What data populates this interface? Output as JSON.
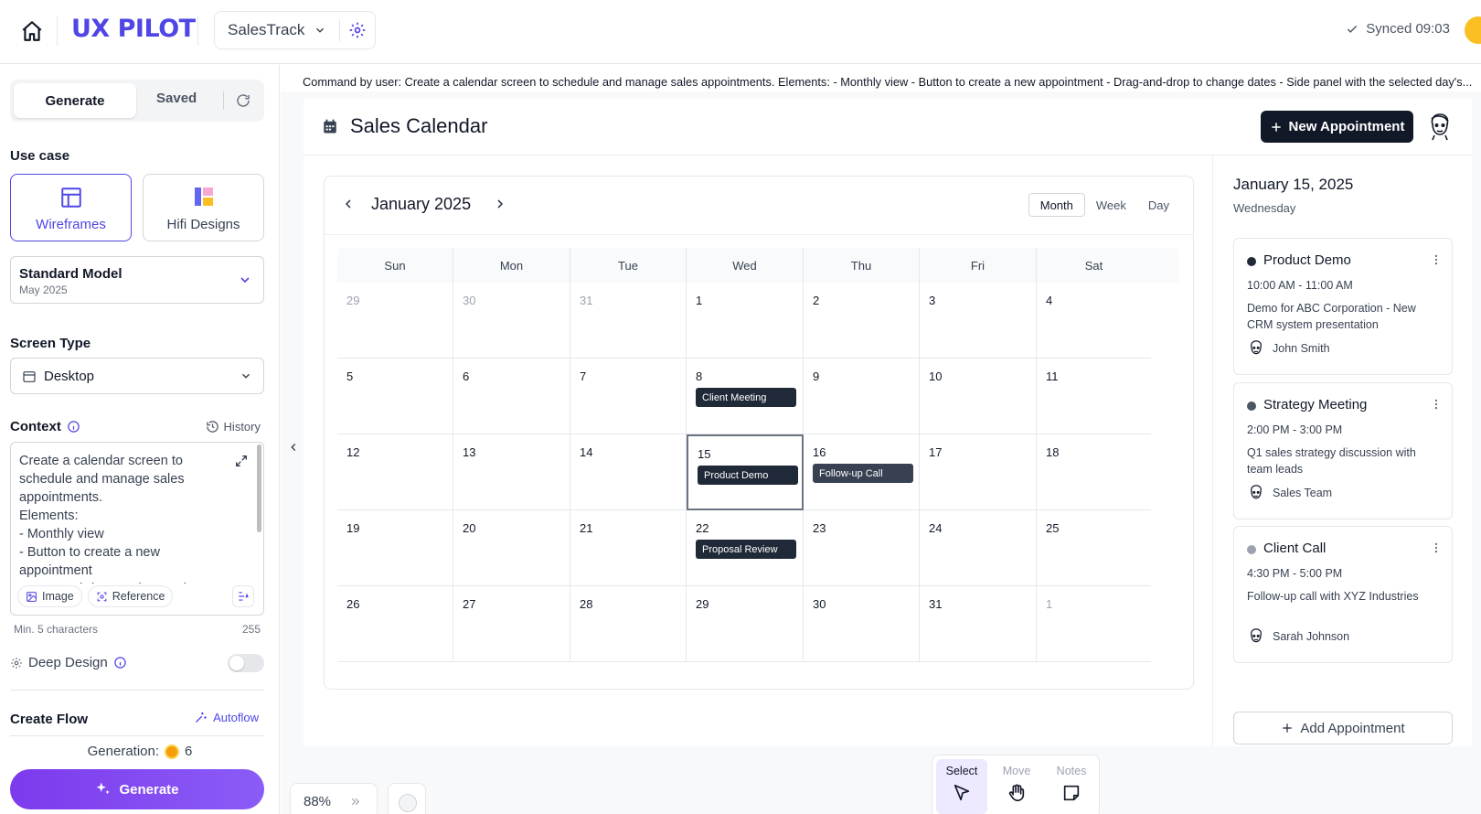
{
  "app": {
    "logo": "UX PILOT",
    "project": "SalesTrack",
    "sync_status": "Synced 09:03"
  },
  "left": {
    "tabs": {
      "generate": "Generate",
      "saved": "Saved"
    },
    "use_case_label": "Use case",
    "use_cases": [
      {
        "label": "Wireframes"
      },
      {
        "label": "Hifi Designs"
      }
    ],
    "model": {
      "name": "Standard Model",
      "date": "May 2025"
    },
    "screen_type_label": "Screen Type",
    "screen_type": "Desktop",
    "context_label": "Context",
    "history_label": "History",
    "context_text": "Create a calendar screen to schedule and manage sales appointments.\nElements:\n- Monthly view\n- Button to create a new appointment\n- Drag-and-drop to change dates",
    "chips": {
      "image": "Image",
      "reference": "Reference"
    },
    "min_chars": "Min. 5 characters",
    "max_chars": "255",
    "deep_design": "Deep Design",
    "create_flow": "Create Flow",
    "autoflow": "Autoflow",
    "generation_label": "Generation:",
    "generation_count": "6",
    "generate_button": "Generate"
  },
  "command": "Command by user: Create a calendar screen to schedule and manage sales appointments. Elements: - Monthly view - Button to create a new appointment - Drag-and-drop to change dates - Side panel with the selected day's...",
  "screen": {
    "title": "Sales Calendar",
    "new_appointment": "New Appointment",
    "month_title": "January 2025",
    "views": [
      "Month",
      "Week",
      "Day"
    ],
    "weekdays": [
      "Sun",
      "Mon",
      "Tue",
      "Wed",
      "Thu",
      "Fri",
      "Sat"
    ],
    "weeks": [
      [
        {
          "d": "29",
          "dim": true
        },
        {
          "d": "30",
          "dim": true
        },
        {
          "d": "31",
          "dim": true
        },
        {
          "d": "1"
        },
        {
          "d": "2"
        },
        {
          "d": "3"
        },
        {
          "d": "4"
        }
      ],
      [
        {
          "d": "5"
        },
        {
          "d": "6"
        },
        {
          "d": "7"
        },
        {
          "d": "8",
          "event": "Client Meeting"
        },
        {
          "d": "9"
        },
        {
          "d": "10"
        },
        {
          "d": "11"
        }
      ],
      [
        {
          "d": "12"
        },
        {
          "d": "13"
        },
        {
          "d": "14"
        },
        {
          "d": "15",
          "event": "Product Demo",
          "selected": true
        },
        {
          "d": "16",
          "event": "Follow-up Call",
          "alt": true
        },
        {
          "d": "17"
        },
        {
          "d": "18"
        }
      ],
      [
        {
          "d": "19"
        },
        {
          "d": "20"
        },
        {
          "d": "21"
        },
        {
          "d": "22",
          "event": "Proposal Review"
        },
        {
          "d": "23"
        },
        {
          "d": "24"
        },
        {
          "d": "25"
        }
      ],
      [
        {
          "d": "26"
        },
        {
          "d": "27"
        },
        {
          "d": "28"
        },
        {
          "d": "29"
        },
        {
          "d": "30"
        },
        {
          "d": "31"
        },
        {
          "d": "1",
          "dim": true
        }
      ]
    ],
    "side": {
      "date": "January 15, 2025",
      "weekday": "Wednesday",
      "appointments": [
        {
          "title": "Product Demo",
          "time": "10:00 AM - 11:00 AM",
          "desc": "Demo for ABC Corporation - New CRM system presentation",
          "person": "John Smith",
          "dot": "#1f2937"
        },
        {
          "title": "Strategy Meeting",
          "time": "2:00 PM - 3:00 PM",
          "desc": "Q1 sales strategy discussion with team leads",
          "person": "Sales Team",
          "dot": "#4b5563"
        },
        {
          "title": "Client Call",
          "time": "4:30 PM - 5:00 PM",
          "desc": "Follow-up call with XYZ Industries",
          "person": "Sarah Johnson",
          "dot": "#9ca3af"
        }
      ],
      "add_appointment": "Add Appointment"
    }
  },
  "bottom": {
    "zoom": "88%",
    "tools": [
      "Select",
      "Move",
      "Notes"
    ]
  },
  "colors": {
    "brand": "#4f46e5",
    "generate_gradient_start": "#7c3aed",
    "dark": "#111827"
  }
}
